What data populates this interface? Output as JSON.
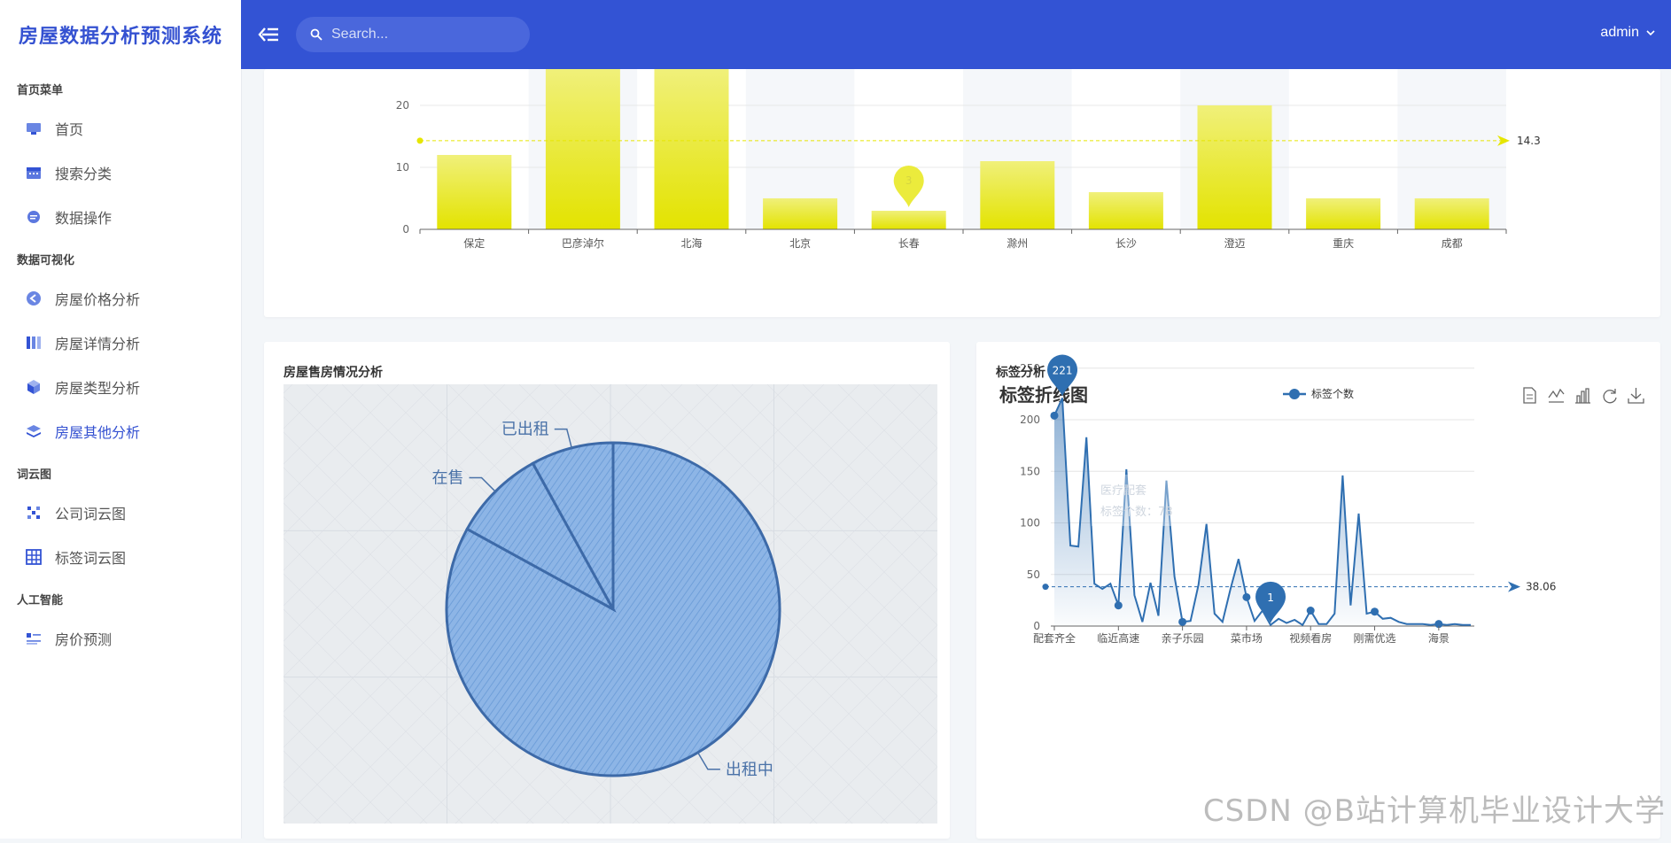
{
  "app": {
    "title": "房屋数据分析预测系统"
  },
  "topbar": {
    "search_placeholder": "Search...",
    "user": "admin"
  },
  "sidebar": {
    "groups": [
      {
        "label": "首页菜单",
        "items": [
          {
            "label": "首页",
            "icon": "monitor-icon"
          },
          {
            "label": "搜索分类",
            "icon": "calendar-icon"
          },
          {
            "label": "数据操作",
            "icon": "chat-icon"
          }
        ]
      },
      {
        "label": "数据可视化",
        "items": [
          {
            "label": "房屋价格分析",
            "icon": "arrow-circle-icon"
          },
          {
            "label": "房屋详情分析",
            "icon": "columns-icon"
          },
          {
            "label": "房屋类型分析",
            "icon": "cube-icon"
          },
          {
            "label": "房屋其他分析",
            "icon": "layers-icon",
            "active": true
          }
        ]
      },
      {
        "label": "词云图",
        "items": [
          {
            "label": "公司词云图",
            "icon": "scatter-icon"
          },
          {
            "label": "标签词云图",
            "icon": "grid-icon"
          }
        ]
      },
      {
        "label": "人工智能",
        "items": [
          {
            "label": "房价预测",
            "icon": "list-icon"
          }
        ]
      }
    ]
  },
  "colors": {
    "accent": "#3353d4",
    "bar": "#e6e600",
    "line": "#2f6fb1",
    "pie": "#5f92d3"
  },
  "pie_card": {
    "title": "房屋售房情况分析"
  },
  "line_card": {
    "title": "标签分析"
  },
  "watermark": "CSDN @B站计算机毕业设计大学",
  "chart_data": [
    {
      "type": "bar",
      "title": "",
      "categories": [
        "保定",
        "巴彦淖尔",
        "北海",
        "北京",
        "长春",
        "滁州",
        "长沙",
        "澄迈",
        "重庆",
        "成都"
      ],
      "values": [
        12,
        26,
        26,
        5,
        3,
        11,
        6,
        20,
        5,
        5
      ],
      "ylim": [
        0,
        26
      ],
      "yticks": [
        "0",
        "10",
        "20"
      ],
      "average_line": {
        "value": 14.3,
        "label": "14.3"
      },
      "min_pin": {
        "category": "长春",
        "label": "3"
      },
      "grid": true
    },
    {
      "type": "pie",
      "title": "",
      "slices": [
        {
          "label": "出租中",
          "value": 83
        },
        {
          "label": "在售",
          "value": 9
        },
        {
          "label": "已出租",
          "value": 8
        }
      ]
    },
    {
      "type": "area",
      "title": "标签折线图",
      "legend": {
        "entry": "标签个数",
        "position": "top"
      },
      "x_tick_labels": [
        "配套齐全",
        "临近高速",
        "亲子乐园",
        "菜市场",
        "视频看房",
        "刚需优选",
        "海景"
      ],
      "ylim": [
        0,
        250
      ],
      "yticks": [
        "0",
        "50",
        "100",
        "150",
        "200",
        "250"
      ],
      "series": [
        {
          "name": "标签个数",
          "values": [
            204,
            221,
            78,
            77,
            183,
            41,
            36,
            41,
            20,
            152,
            30,
            4,
            42,
            10,
            141,
            48,
            4,
            5,
            40,
            99,
            12,
            4,
            36,
            65,
            28,
            5,
            15,
            1,
            7,
            3,
            6,
            1,
            15,
            2,
            2,
            12,
            146,
            20,
            109,
            12,
            14,
            7,
            8,
            4,
            2,
            2,
            2,
            1,
            2,
            1,
            2,
            1,
            1
          ]
        }
      ],
      "max_pin": {
        "label": "221"
      },
      "min_pin": {
        "label": "1"
      },
      "average_line": {
        "value": 38.06,
        "label": "38.06"
      },
      "faded_tooltip": {
        "line1": "医疗配套",
        "line2": "标签个数：78"
      },
      "toolbox": [
        "data-view-icon",
        "line-chart-icon",
        "bar-chart-icon",
        "restore-icon",
        "download-icon"
      ]
    }
  ]
}
